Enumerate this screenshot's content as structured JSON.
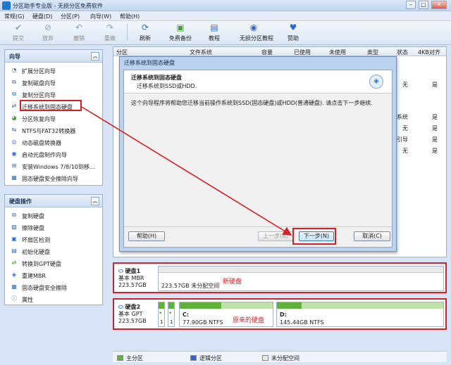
{
  "window": {
    "title": "分区助手专业版 - 无损分区免费软件",
    "min": "–",
    "max": "□",
    "close": "✕"
  },
  "menu": [
    "常规(G)",
    "硬盘(D)",
    "分区(P)",
    "向导(W)",
    "帮助(H)"
  ],
  "toolbar": [
    {
      "label": "提交",
      "icon": "✔",
      "enabled": false
    },
    {
      "label": "放弃",
      "icon": "⊘",
      "enabled": false
    },
    {
      "label": "撤销",
      "icon": "↶",
      "enabled": false
    },
    {
      "label": "重做",
      "icon": "↷",
      "enabled": false
    },
    {
      "label": "刷新",
      "icon": "⟳",
      "enabled": true
    },
    {
      "label": "免费备份",
      "icon": "▣",
      "enabled": true
    },
    {
      "label": "教程",
      "icon": "▤",
      "enabled": true
    },
    {
      "label": "无损分区教程",
      "icon": "◉",
      "enabled": true
    },
    {
      "label": "赞助",
      "icon": "♥",
      "enabled": true
    }
  ],
  "wizard_panel": {
    "title": "向导",
    "items": [
      "扩展分区向导",
      "复制磁盘向导",
      "复制分区向导",
      "迁移系统到固态硬盘",
      "分区恢复向导",
      "NTFS与FAT32转换器",
      "动态磁盘转换器",
      "启动光盘制作向导",
      "安装Windows 7/8/10到移...",
      "固态硬盘安全擦除向导"
    ]
  },
  "disk_panel": {
    "title": "硬盘操作",
    "items": [
      "复制硬盘",
      "擦除硬盘",
      "坏扇区检测",
      "初始化硬盘",
      "转换到GPT硬盘",
      "重建MBR",
      "固态硬盘安全擦除",
      "属性"
    ]
  },
  "grid": {
    "columns": [
      "分区",
      "文件系统",
      "容量",
      "已使用",
      "未使用",
      "类型",
      "状态",
      "4KB对齐"
    ],
    "right_cells": [
      {
        "status": "无",
        "align": "是"
      },
      {
        "status": "系统",
        "align": "是"
      },
      {
        "status": "无",
        "align": "是"
      },
      {
        "status": "引导",
        "align": "是"
      },
      {
        "status": "无",
        "align": "是"
      },
      {
        "status": "无",
        "align": "是"
      }
    ]
  },
  "dialog": {
    "title": "迁移系统到固态硬盘",
    "heading": "迁移系统到固态硬盘",
    "subheading": "迁移系统到SSD或HDD.",
    "body": "这个向导程序将帮助您迁移当前操作系统到SSD(固态硬盘)或HDD(普通硬盘). 请点击下一步继续.",
    "help": "帮助(H)",
    "prev": "上一步(B)",
    "next": "下一步(N)",
    "cancel": "取消(C)"
  },
  "disk1": {
    "name": "硬盘1",
    "type": "基本 MBR",
    "size": "223.57GB",
    "partition": "223.57GB 未分配空间",
    "annotation": "新硬盘"
  },
  "disk2": {
    "name": "硬盘2",
    "type": "基本 GPT",
    "size": "223.57GB",
    "small": [
      {
        "letter": "*",
        "num": "1"
      },
      {
        "letter": "*",
        "num": "1"
      }
    ],
    "c": {
      "letter": "C:",
      "info": "77.90GB NTFS",
      "used_fraction": 0.45
    },
    "d": {
      "letter": "D:",
      "info": "145.44GB NTFS",
      "used_fraction": 0.15
    },
    "annotation": "原来的硬盘"
  },
  "legend": [
    "主分区",
    "逻辑分区",
    "未分配空间"
  ],
  "colors": {
    "primary": "#5fb23a",
    "logical": "#3a62c9",
    "unallocated": "#e9e9e9",
    "annotation": "#d61f26"
  }
}
